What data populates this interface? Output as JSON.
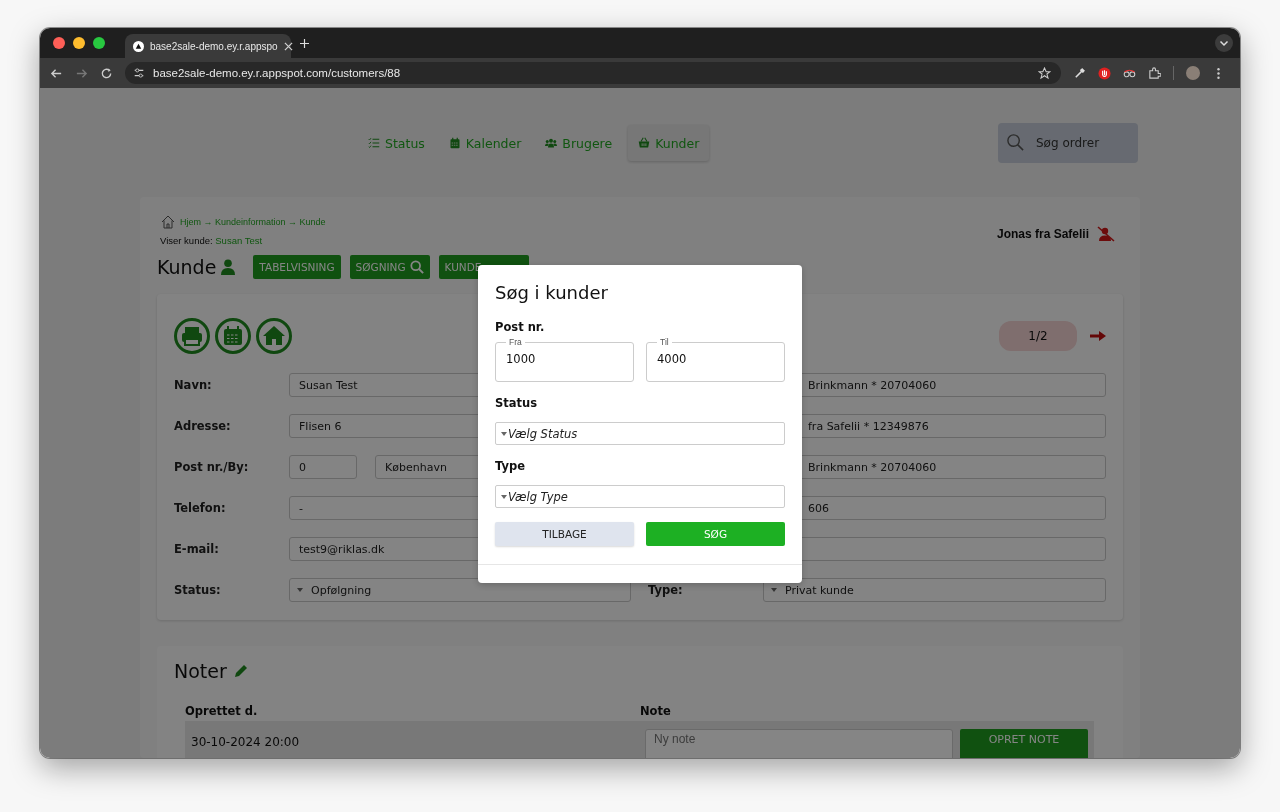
{
  "browser": {
    "tab_title": "base2sale-demo.ey.r.appspo",
    "url": "base2sale-demo.ey.r.appspot.com/customers/88"
  },
  "nav": {
    "items": [
      {
        "label": "Status",
        "selected": false
      },
      {
        "label": "Kalender",
        "selected": false
      },
      {
        "label": "Brugere",
        "selected": false
      },
      {
        "label": "Kunder",
        "selected": true
      }
    ],
    "search_placeholder": "Søg ordrer"
  },
  "header": {
    "breadcrumb": "Hjem → Kundeinformation → Kunde",
    "viewing_label": "Viser kunde:",
    "viewing_name": "Susan Test",
    "title": "Kunde",
    "buttons": [
      "TABELVISNING",
      "SØGNING",
      "KUNDE"
    ],
    "user": "Jonas fra Safelii"
  },
  "customer": {
    "pager": "1/2",
    "left": [
      {
        "label": "Navn:",
        "kind": "text",
        "value": "Susan Test"
      },
      {
        "label": "Adresse:",
        "kind": "text",
        "value": "Flisen 6"
      },
      {
        "label": "Post nr./By:",
        "kind": "pair",
        "value": "0",
        "value2": "København"
      },
      {
        "label": "Telefon:",
        "kind": "text",
        "value": "-"
      },
      {
        "label": "E-mail:",
        "kind": "text",
        "value": "test9@riklas.dk"
      },
      {
        "label": "Status:",
        "kind": "select",
        "value": "Opfølgning"
      }
    ],
    "right": [
      {
        "kind": "text",
        "value": "Brinkmann * 20704060"
      },
      {
        "kind": "text",
        "value": "fra Safelii * 12349876"
      },
      {
        "kind": "text",
        "value": "Brinkmann * 20704060"
      },
      {
        "kind": "text",
        "value": "606"
      },
      {
        "kind": "text"
      },
      {
        "kind": "select",
        "label": "Type:",
        "value": "Privat kunde"
      }
    ]
  },
  "notes": {
    "title": "Noter",
    "columns": [
      "Oprettet d.",
      "Note"
    ],
    "row_date": "30-10-2024 20:00",
    "note_placeholder": "Ny note",
    "button": "OPRET NOTE"
  },
  "modal": {
    "title": "Søg i kunder",
    "post_label": "Post nr.",
    "from": {
      "legend": "Fra",
      "value": "1000"
    },
    "to": {
      "legend": "Til",
      "value": "4000"
    },
    "status_label": "Status",
    "status_placeholder": "Vælg Status",
    "type_label": "Type",
    "type_placeholder": "Vælg Type",
    "buttons": [
      {
        "label": "TILBAGE",
        "kind": "secondary"
      },
      {
        "label": "SØG",
        "kind": "primary"
      }
    ]
  }
}
